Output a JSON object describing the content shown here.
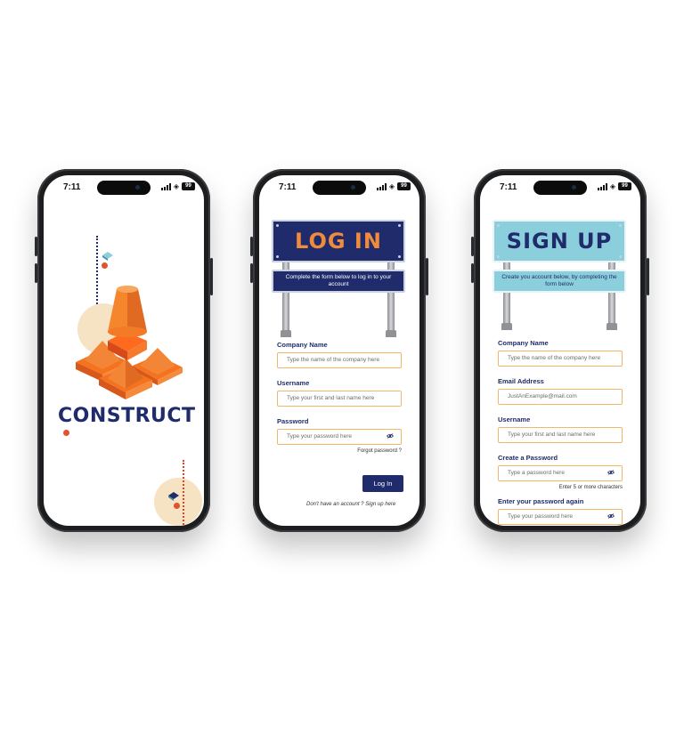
{
  "status_bar": {
    "time": "7:11",
    "battery": "99"
  },
  "splash": {
    "brand": "CONSTRUCT"
  },
  "login": {
    "title": "LOG IN",
    "subtitle": "Complete the form below to log in to your account",
    "fields": [
      {
        "label": "Company Name",
        "placeholder": "Type the name of the company here"
      },
      {
        "label": "Username",
        "placeholder": "Type your first and last name here"
      },
      {
        "label": "Password",
        "placeholder": "Type your password here"
      }
    ],
    "forgot": "Forgot password ?",
    "button": "Log In",
    "footer": "Don't have an account ? Sign up here"
  },
  "signup": {
    "title": "SIGN UP",
    "subtitle": "Create you account below, by completing the form below",
    "fields": [
      {
        "label": "Company Name",
        "placeholder": "Type the name of the company here"
      },
      {
        "label": "Email Address",
        "placeholder": "JustAnExample@mail.com"
      },
      {
        "label": "Username",
        "placeholder": "Type your first and last name here"
      },
      {
        "label": "Create a Password",
        "placeholder": "Type a password here",
        "hint": "Enter 5 or more characters"
      },
      {
        "label": "Enter your password again",
        "placeholder": "Type your password here"
      }
    ]
  },
  "colors": {
    "navy": "#1f2b6b",
    "orange": "#f08a3c",
    "light_blue": "#8ccfdc",
    "field_border": "#f2b769"
  }
}
